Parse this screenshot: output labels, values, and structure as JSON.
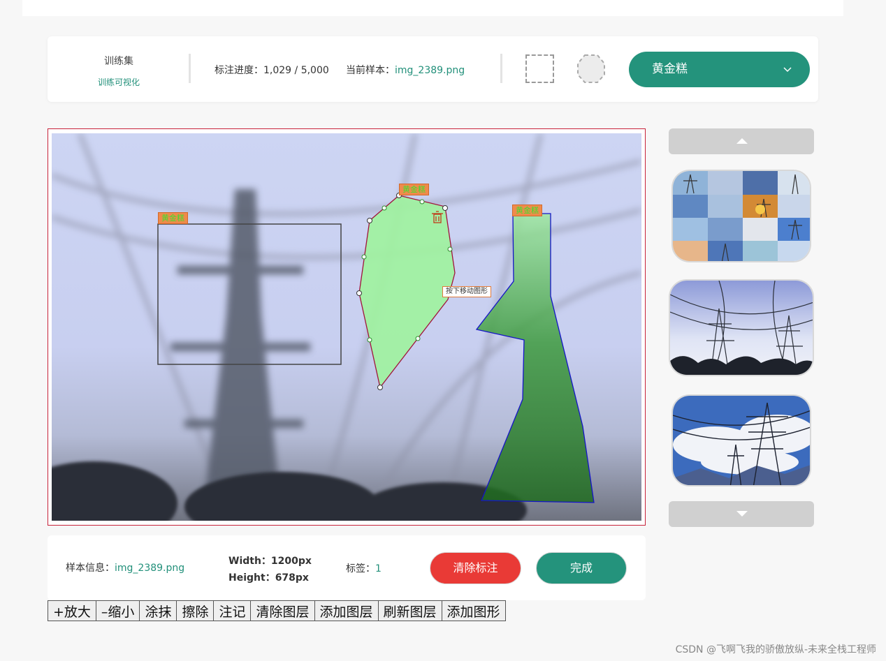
{
  "toolbar": {
    "dataset_name": "训练集",
    "dataset_link": "训练可视化",
    "progress_label": "标注进度：",
    "progress_value": "1,029 / 5,000",
    "current_label": "当前样本：",
    "current_value": "img_2389.png",
    "tools": [
      "rect-tool-icon",
      "polygon-tool-icon"
    ],
    "selected_label": "黄金糕"
  },
  "canvas": {
    "annotations": [
      {
        "type": "rectangle",
        "label": "黄金糕"
      },
      {
        "type": "polygon",
        "label": "黄金糕",
        "selected": true
      },
      {
        "type": "polygon",
        "label": "黄金糕"
      }
    ],
    "hint": "按下移动图形",
    "delete_icon": "trash-icon"
  },
  "sidebar": {
    "up_icon": "caret-up-icon",
    "down_icon": "caret-down-icon",
    "thumbnails": [
      "thumbnail-grid",
      "thumbnail-towers",
      "thumbnail-sky-tower"
    ]
  },
  "info": {
    "sample_label": "样本信息：",
    "sample_value": "img_2389.png",
    "width_text": "Width：1200px",
    "height_text": "Height：678px",
    "tag_label": "标签：",
    "tag_value": "1",
    "clear_button": "清除标注",
    "done_button": "完成"
  },
  "actions": [
    "+放大",
    "–缩小",
    "涂抹",
    "擦除",
    "注记",
    "清除图层",
    "添加图层",
    "刷新图层",
    "添加图形"
  ],
  "watermark": "CSDN @飞啊飞我的骄傲放纵-未来全栈工程师",
  "colors": {
    "accent": "#24937c",
    "danger": "#e93a36",
    "canvas_border": "#c7223a",
    "tag_bg": "#f08a4b"
  }
}
